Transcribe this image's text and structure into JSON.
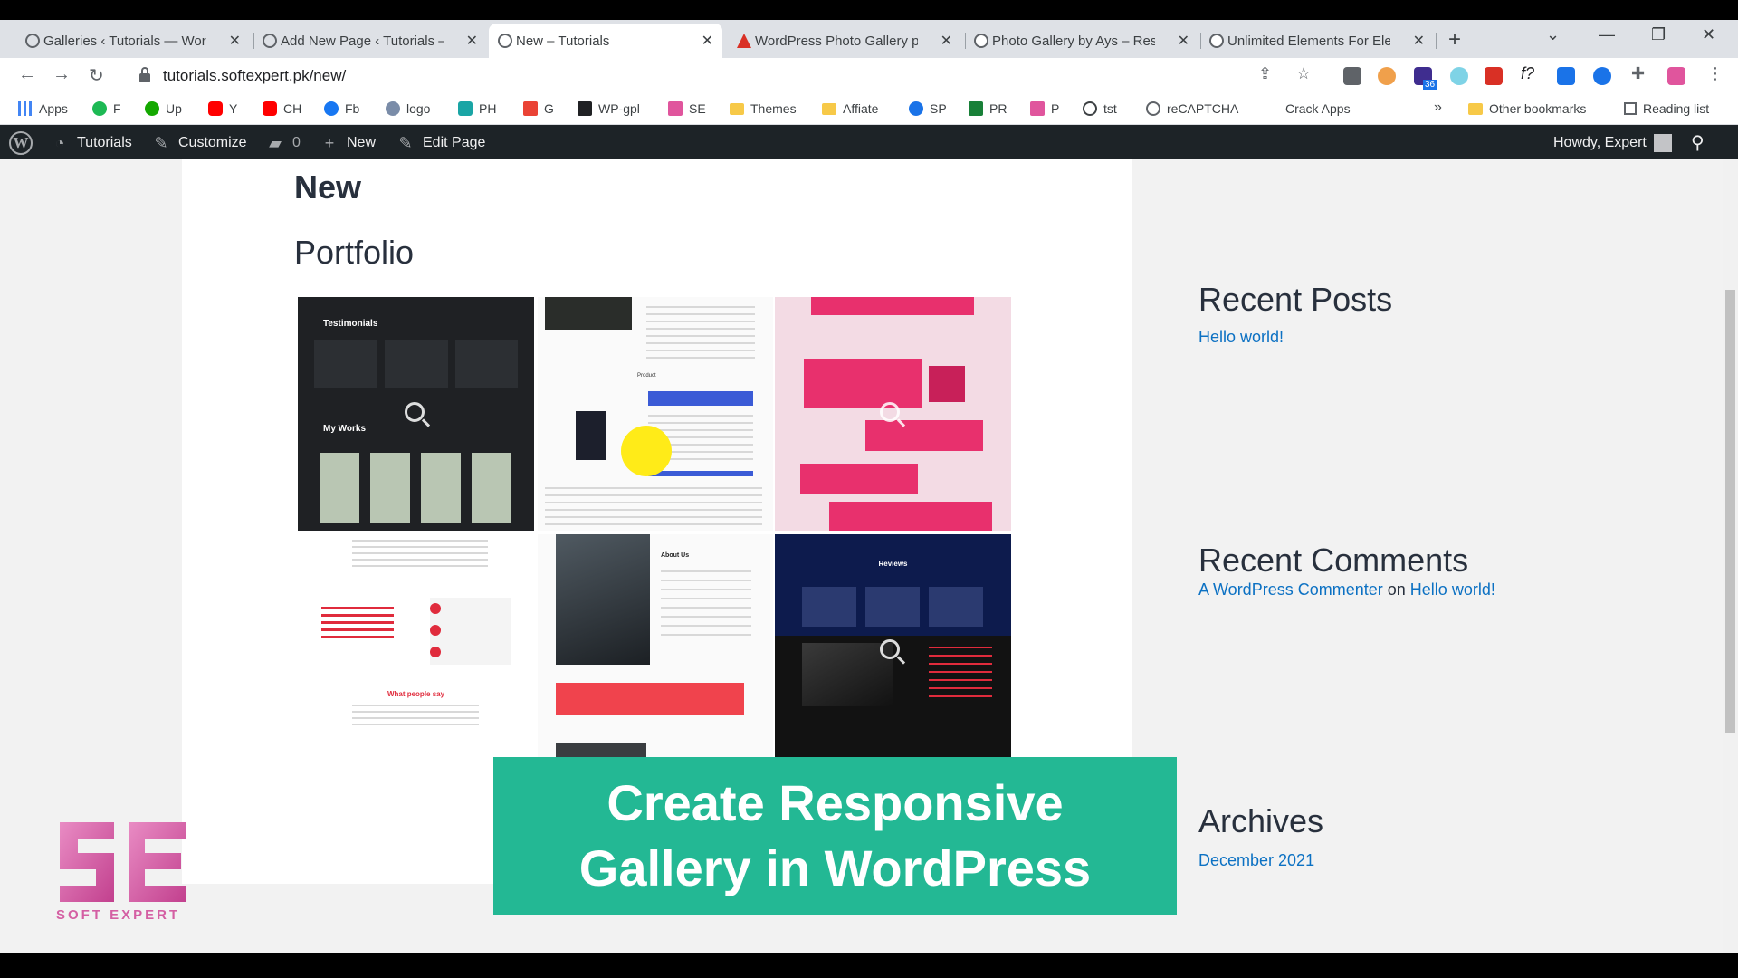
{
  "browser": {
    "tabs": [
      {
        "title": "Galleries ‹ Tutorials — WordPress",
        "active": false
      },
      {
        "title": "Add New Page ‹ Tutorials — WordPress",
        "active": false
      },
      {
        "title": "New – Tutorials",
        "active": true
      },
      {
        "title": "WordPress Photo Gallery plugin",
        "active": false
      },
      {
        "title": "Photo Gallery by Ays – Responsive",
        "active": false
      },
      {
        "title": "Unlimited Elements For Elementor",
        "active": false
      }
    ],
    "new_tab_label": "+",
    "url": "tutorials.softexpert.pk/new/",
    "bookmarks": [
      "Apps",
      "F",
      "Up",
      "Y",
      "CH",
      "Fb",
      "logo",
      "PH",
      "G",
      "WP-gpl",
      "SE",
      "Themes",
      "Affiate",
      "SP",
      "PR",
      "P",
      "tst",
      "reCAPTCHA",
      "Crack Apps"
    ],
    "bookmarks_overflow": "»",
    "other_bookmarks": "Other bookmarks",
    "reading_list": "Reading list",
    "extension_badge": "36"
  },
  "adminbar": {
    "site_name": "Tutorials",
    "customize": "Customize",
    "comments_count": "0",
    "new_label": "New",
    "edit_page": "Edit Page",
    "howdy": "Howdy, Expert"
  },
  "page": {
    "title": "New",
    "portfolio_heading": "Portfolio",
    "gallery_images": [
      {
        "label": "Testimonials",
        "sublabel": "My Works"
      },
      {
        "label": "Product"
      },
      {
        "label": ""
      },
      {
        "label": "What people say"
      },
      {
        "label": "About Us"
      },
      {
        "label": "Reviews"
      }
    ]
  },
  "sidebar": {
    "recent_posts_title": "Recent Posts",
    "recent_post_1": "Hello world!",
    "recent_comments_title": "Recent Comments",
    "comment_author": "A WordPress Commenter",
    "comment_on": "on",
    "comment_post": "Hello world!",
    "archives_title": "Archives",
    "archive_1": "December 2021"
  },
  "overlay": {
    "banner_line_1": "Create Responsive",
    "banner_line_2": "Gallery in WordPress",
    "logo_tagline": "SOFT EXPERT"
  }
}
